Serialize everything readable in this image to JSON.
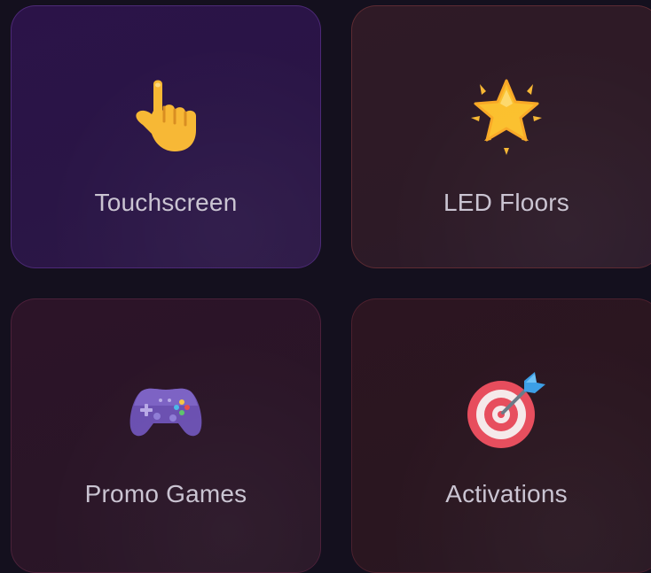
{
  "cards": [
    {
      "label": "Touchscreen",
      "icon": "pointing-hand-icon",
      "accent": "#8c50d2"
    },
    {
      "label": "LED Floors",
      "icon": "glowing-star-icon",
      "accent": "#aa4646"
    },
    {
      "label": "Promo Games",
      "icon": "game-controller-icon",
      "accent": "#963c64"
    },
    {
      "label": "Activations",
      "icon": "direct-hit-target-icon",
      "accent": "#96374b"
    }
  ]
}
